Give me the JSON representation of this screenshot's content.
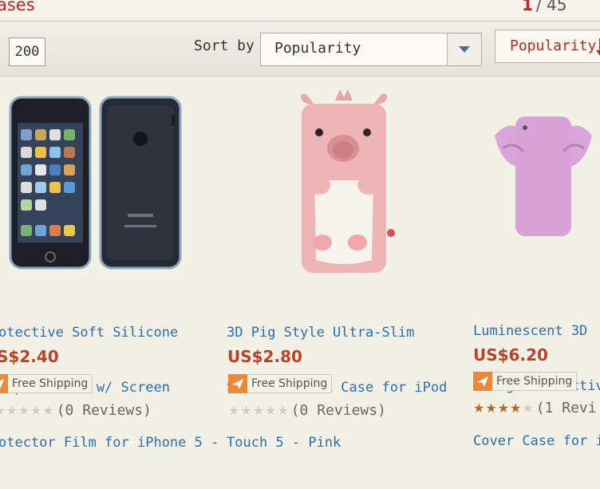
{
  "header": {
    "category_title": "ases",
    "pager": {
      "current": "1",
      "separator": "/",
      "total": "45"
    }
  },
  "toolbar": {
    "per_page": "200",
    "sort_by_label": "Sort by",
    "sort_selected": "Popularity",
    "sort_button_label": "Popularity"
  },
  "products": [
    {
      "title_lines": [
        "otective Soft Silicone",
        "imper Frame w/ Screen",
        "otector Film for iPhone 5 -"
      ],
      "price": "S$2.40",
      "shipping": "Free Shipping",
      "rating_stars": 0,
      "reviews": "(0 Reviews)"
    },
    {
      "title_lines": [
        "3D Pig Style Ultra-Slim",
        "Silicone Back Case for iPod",
        "Touch 5 - Pink"
      ],
      "price": "US$2.80",
      "shipping": "Free Shipping",
      "rating_stars": 0,
      "reviews": "(0 Reviews)"
    },
    {
      "title_lines": [
        "Luminescent 3D",
        "Design Protectiv",
        "Cover Case for i"
      ],
      "price": "US$6.20",
      "shipping": "Free Shipping",
      "rating_stars": 4,
      "reviews": "(1 Revi"
    }
  ],
  "colors": {
    "accent_red": "#b52a24",
    "price": "#b8432a",
    "link_blue": "#2a6fb0",
    "shipping_orange": "#e98a3a"
  }
}
